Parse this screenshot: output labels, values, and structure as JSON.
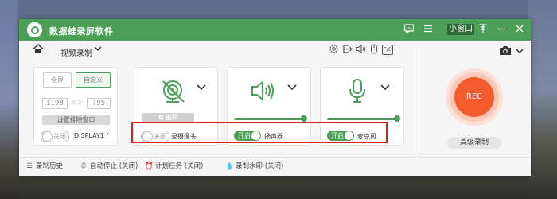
{
  "app": {
    "title": "数据蛙录屏软件",
    "mini_window_label": "小窗口",
    "accent": "#4b9f56",
    "rec_color": "#f35b2d"
  },
  "titlebar_icons": [
    "chat-icon",
    "menu-icon",
    "pin-icon",
    "minimize-icon",
    "close-icon"
  ],
  "mode": {
    "label": "视频录制"
  },
  "toolbar_icons": [
    "gear-icon",
    "export-icon",
    "speaker-icon",
    "mouse-icon",
    "fn-icon"
  ],
  "fn_label": "F/8",
  "screen": {
    "fullscreen_label": "全屏",
    "custom_label": "自定义",
    "width": "1198",
    "height": "795",
    "exclude_label": "设置排除窗口",
    "toggle_label": "关闭",
    "display_label": "DISPLAY1"
  },
  "webcam": {
    "photo_label": "拍照",
    "toggle_label": "关闭",
    "device_label": "录摄像头"
  },
  "speaker": {
    "toggle_label": "开启",
    "device_label": "扬声器",
    "volume": 1.0
  },
  "mic": {
    "toggle_label": "开启",
    "device_label": "麦克风",
    "volume": 1.0
  },
  "rec": {
    "label": "REC",
    "advanced_label": "高级录制"
  },
  "footer": {
    "history": "录制历史",
    "auto_stop": "自动停止 (关闭)",
    "schedule": "计划任务 (关闭)",
    "watermark": "录制水印 (关闭)"
  }
}
